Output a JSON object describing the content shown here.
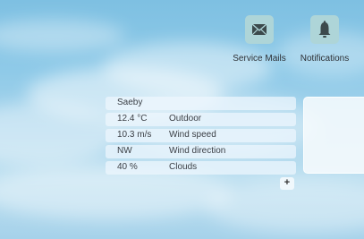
{
  "toolbar": {
    "service_mails_label": "Service Mails",
    "notifications_label": "Notifications",
    "service_mails_icon": "envelope-icon",
    "notifications_icon": "bell-icon"
  },
  "weather": {
    "location": "Saeby",
    "rows": [
      {
        "value": "12.4 °C",
        "label": "Outdoor"
      },
      {
        "value": "10.3 m/s",
        "label": "Wind speed"
      },
      {
        "value": "NW",
        "label": "Wind direction"
      },
      {
        "value": "40 %",
        "label": "Clouds"
      }
    ],
    "add_label": "+"
  },
  "colors": {
    "sky": "#8fcae8",
    "tile": "#aed5d8",
    "icon": "#3c4a4c"
  }
}
